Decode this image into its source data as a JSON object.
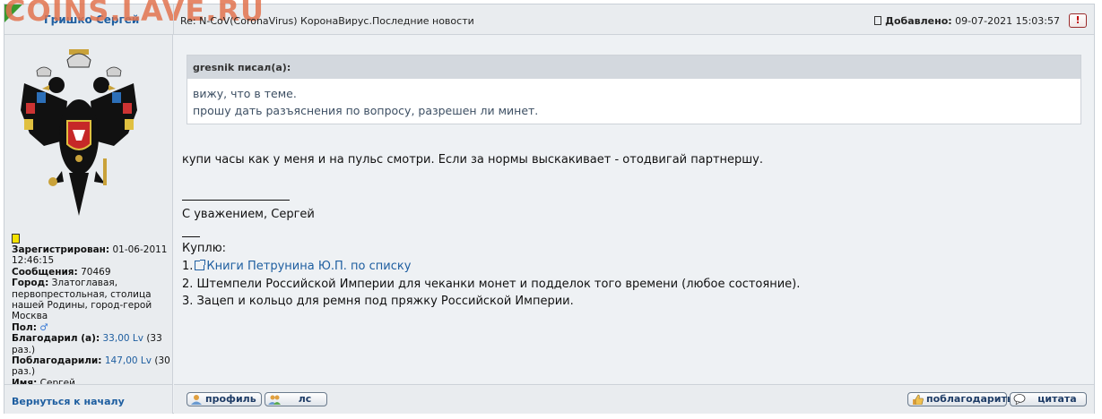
{
  "watermark": "COINS.LAVE.RU",
  "post": {
    "author": "Гришко Сергей",
    "topic": "Re: N-CoV(CoronaVirus) КоронаВирус.Последние новости",
    "posted_label": "Добавлено:",
    "posted_date": "09-07-2021 15:03:57",
    "report_label": "!"
  },
  "profile": {
    "registered_label": "Зарегистрирован:",
    "registered_value": "01-06-2011 12:46:15",
    "messages_label": "Сообщения:",
    "messages_value": "70469",
    "city_label": "Город:",
    "city_value": "Златоглавая, первопрестольная, столица нашей Родины, город-герой Москва",
    "gender_label": "Пол:",
    "gender_symbol": "♂",
    "thanked_label": "Благодарил (а):",
    "thanked_value": "33,00 Lv",
    "thanked_count": "(33 раз.)",
    "got_thanks_label": "Поблагодарили:",
    "got_thanks_value": "147,00 Lv",
    "got_thanks_count": "(30 раз.)",
    "name_label": "Имя:",
    "name_value": "Сергей",
    "online_color": "#f4e200"
  },
  "quote": {
    "header": "gresnik писал(а):",
    "line1": "вижу, что в теме.",
    "line2": "прошу дать разъяснения по вопросу, разрешен ли минет."
  },
  "message": {
    "main": "купи часы как у меня и на пульс смотри. Если за нормы выскакивает - отодвигай партнершу.",
    "signature": "С уважением, Сергей",
    "buy_heading": "Куплю:",
    "item1_num": "1.",
    "item1_link": "Книги Петрунина Ю.П. по списку",
    "item2": "2. Штемпели Российской Империи для чеканки монет и подделок того времени (любое состояние).",
    "item3": "3. Зацеп и кольцо для ремня под пряжку Российской Империи."
  },
  "footer": {
    "back_to_top": "Вернуться к началу",
    "profile_btn": "профиль",
    "pm_btn": "лс",
    "thank_btn": "поблагодарить",
    "quote_btn": "цитата"
  },
  "colors": {
    "accent_blue": "#1e5ea0",
    "corner_green": "#3a9a2e",
    "watermark": "#e2744f"
  }
}
